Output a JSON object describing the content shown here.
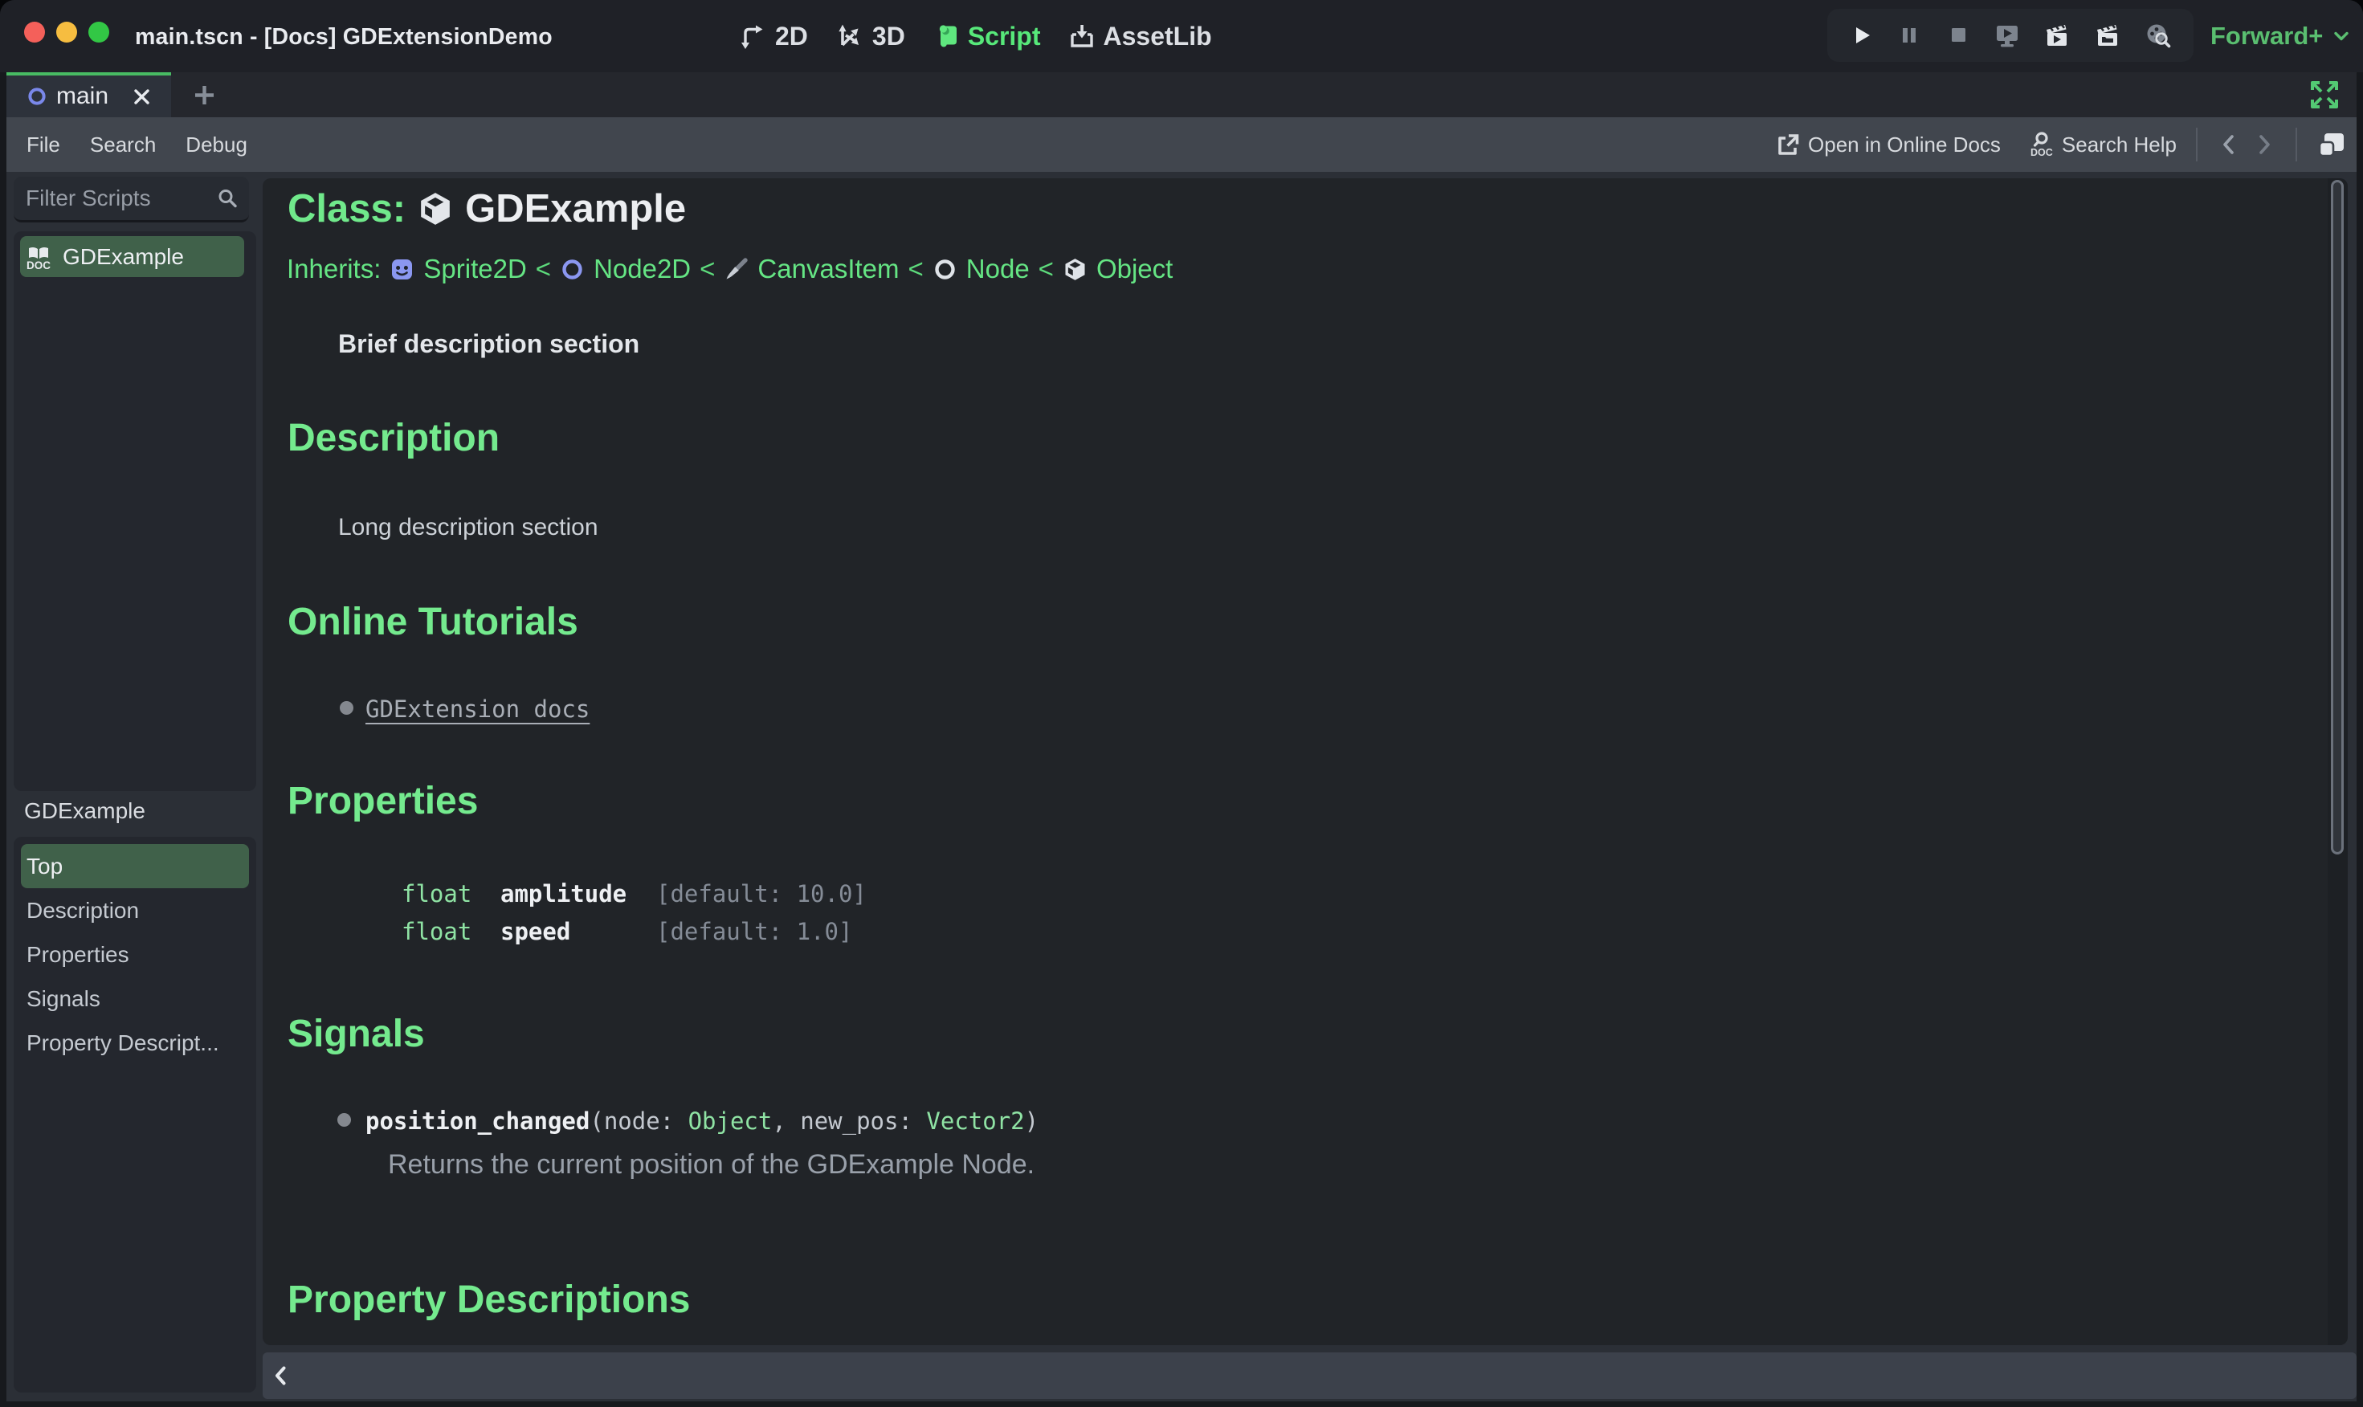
{
  "window": {
    "title": "main.tscn - [Docs] GDExtensionDemo"
  },
  "titlebar": {
    "workspaces": [
      {
        "label": "2D"
      },
      {
        "label": "3D"
      },
      {
        "label": "Script"
      },
      {
        "label": "AssetLib"
      }
    ],
    "renderer": {
      "label": "Forward+"
    }
  },
  "tabs": {
    "active_label": "main"
  },
  "menubar": {
    "items": [
      {
        "label": "File"
      },
      {
        "label": "Search"
      },
      {
        "label": "Debug"
      }
    ],
    "open_online_label": "Open in Online Docs",
    "search_help_label": "Search Help"
  },
  "sidebar": {
    "filter_placeholder": "Filter Scripts",
    "scripts": [
      {
        "label": "GDExample"
      }
    ],
    "outline_title": "GDExample",
    "members": [
      {
        "label": "Top"
      },
      {
        "label": "Description"
      },
      {
        "label": "Properties"
      },
      {
        "label": "Signals"
      },
      {
        "label": "Property Descript..."
      }
    ]
  },
  "doc": {
    "class_label": "Class:",
    "class_name": "GDExample",
    "inherits_label": "Inherits:",
    "separator": "<",
    "inherits": [
      {
        "name": "Sprite2D"
      },
      {
        "name": "Node2D"
      },
      {
        "name": "CanvasItem"
      },
      {
        "name": "Node"
      },
      {
        "name": "Object"
      }
    ],
    "brief": "Brief description section",
    "sections": {
      "description": "Description",
      "tutorials": "Online Tutorials",
      "properties": "Properties",
      "signals": "Signals",
      "property_descriptions": "Property Descriptions"
    },
    "long_description": "Long description section",
    "tutorial_link": "GDExtension docs",
    "properties_table": [
      {
        "type": "float",
        "name": "amplitude",
        "default": "[default: 10.0]"
      },
      {
        "type": "float",
        "name": "speed",
        "default": "[default: 1.0]"
      }
    ],
    "signal": {
      "name": "position_changed",
      "open": "(node: ",
      "arg1_type": "Object",
      "mid": ", new_pos: ",
      "arg2_type": "Vector2",
      "close": ")",
      "description": "Returns the current position of the GDExample Node."
    }
  },
  "colors": {
    "accent_green": "#74ea8e",
    "link_green": "#65e584",
    "type_green": "#8fe3a4",
    "selected_item_bg": "#40614a",
    "tab_accent": "#48bb63",
    "renderer_green": "#5abe70"
  }
}
